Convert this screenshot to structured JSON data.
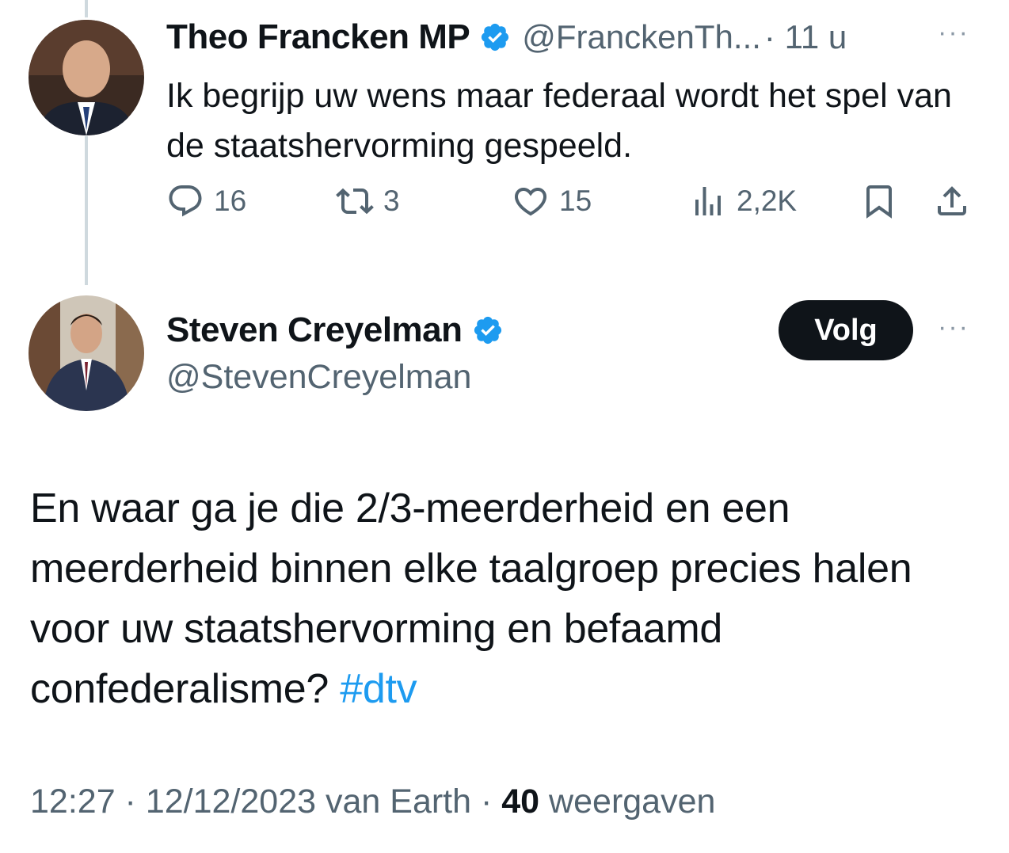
{
  "reply_tweet": {
    "author_name": "Theo Francken MP",
    "handle": "@FranckenTh...",
    "time": "· 11 u",
    "text": "Ik begrijp uw wens maar federaal wordt het spel van de staatshervorming gespeeld.",
    "actions": {
      "replies": "16",
      "retweets": "3",
      "likes": "15",
      "views": "2,2K"
    },
    "more": "···"
  },
  "main_tweet": {
    "author_name": "Steven Creyelman",
    "handle": "@StevenCreyelman",
    "follow_label": "Volg",
    "more": "···",
    "text": "En waar ga je die 2/3-meerderheid en een meerderheid binnen elke taalgroep precies halen voor uw staatshervorming en befaamd confederalisme? ",
    "hashtag": "#dtv",
    "meta": {
      "time": "12:27",
      "sep1": " · ",
      "date": "12/12/2023",
      "source": " van Earth",
      "sep2": " · ",
      "views_count": "40",
      "views_label": " weergaven"
    }
  },
  "colors": {
    "accent": "#1d9bf0",
    "text": "#0f1419",
    "muted": "#536471",
    "thread_line": "#cfd9de"
  },
  "icons": [
    "verified-badge-icon",
    "reply-icon",
    "retweet-icon",
    "like-icon",
    "views-icon",
    "bookmark-icon",
    "share-icon",
    "more-icon"
  ]
}
